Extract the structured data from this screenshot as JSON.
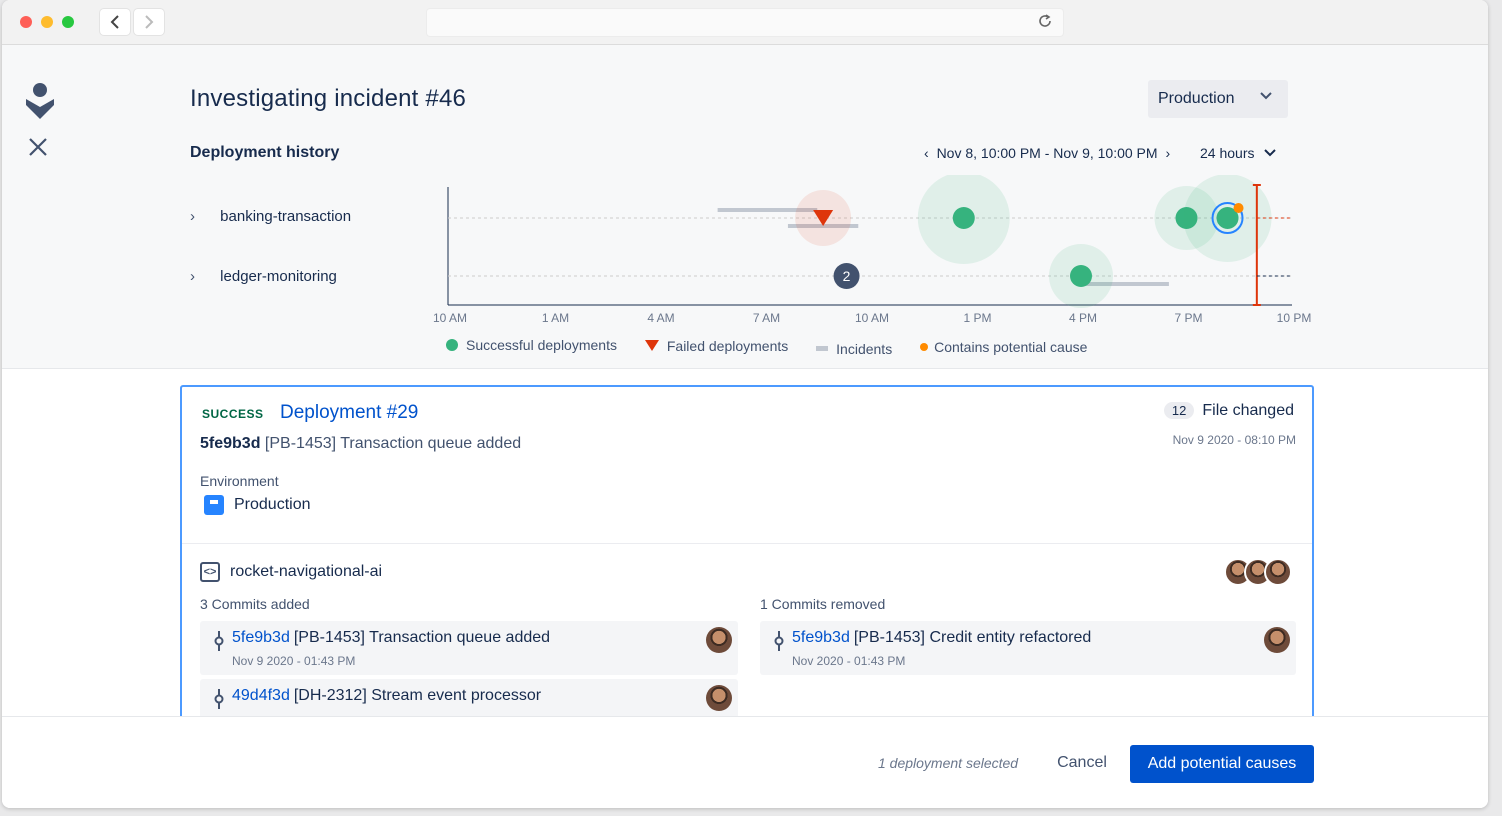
{
  "header": {
    "title": "Investigating incident #46",
    "environment_select": "Production"
  },
  "history": {
    "title": "Deployment history",
    "range": "Nov 8, 10:00 PM - Nov 9, 10:00 PM",
    "range_length": "24 hours",
    "services": [
      "banking-transaction",
      "ledger-monitoring"
    ]
  },
  "chart_data": {
    "type": "scatter",
    "x_ticks": [
      "10 AM",
      "1 AM",
      "4 AM",
      "7 AM",
      "10 AM",
      "1 PM",
      "4 PM",
      "7 PM",
      "10 PM"
    ],
    "rows": [
      "banking-transaction",
      "ledger-monitoring"
    ],
    "successful_deployments": [
      {
        "row": "banking-transaction",
        "time": "12:40 PM"
      },
      {
        "row": "banking-transaction",
        "time": "7:00 PM"
      },
      {
        "row": "banking-transaction",
        "time": "8:10 PM"
      },
      {
        "row": "ledger-monitoring",
        "time": "4:00 PM"
      }
    ],
    "failed_deployments": [
      {
        "row": "banking-transaction",
        "time": "8:40 AM"
      }
    ],
    "incidents": [
      {
        "row": "banking-transaction",
        "start": "5:40 AM",
        "end": "8:30 AM"
      },
      {
        "row": "banking-transaction",
        "start": "7:40 AM",
        "end": "9:40 AM"
      },
      {
        "row": "ledger-monitoring",
        "start": "4:00 PM",
        "end": "6:30 PM"
      }
    ],
    "cluster": {
      "row": "ledger-monitoring",
      "time": "9:20 AM",
      "count": "2"
    },
    "potential_cause": {
      "row": "banking-transaction",
      "time": "8:10 PM"
    },
    "current_time": "9:00 PM",
    "legend": [
      "Successful deployments",
      "Failed deployments",
      "Incidents",
      "Contains potential cause"
    ],
    "colors": {
      "success": "#36b37e",
      "failed": "#de350b",
      "incident": "#c1c7d0",
      "cause": "#ff8b00",
      "marker": "#de350b"
    }
  },
  "deployment": {
    "status": "SUCCESS",
    "title": "Deployment #29",
    "hash": "5fe9b3d",
    "message": "[PB-1453] Transaction queue added",
    "files_count": "12",
    "files_label": "File changed",
    "timestamp": "Nov 9 2020 - 08:10 PM",
    "env_label": "Environment",
    "env_value": "Production",
    "repo": "rocket-navigational-ai",
    "added_title": "3 Commits added",
    "removed_title": "1 Commits removed",
    "added": [
      {
        "hash": "5fe9b3d",
        "msg": "[PB-1453] Transaction queue added",
        "time": "Nov 9 2020 - 01:43 PM"
      },
      {
        "hash": "49d4f3d",
        "msg": "[DH-2312] Stream event processor",
        "time": ""
      }
    ],
    "removed": [
      {
        "hash": "5fe9b3d",
        "msg": "[PB-1453] Credit entity refactored",
        "time": "Nov  2020 - 01:43 PM"
      }
    ]
  },
  "footer": {
    "selection_note": "1 deployment selected",
    "cancel": "Cancel",
    "primary": "Add potential causes"
  }
}
